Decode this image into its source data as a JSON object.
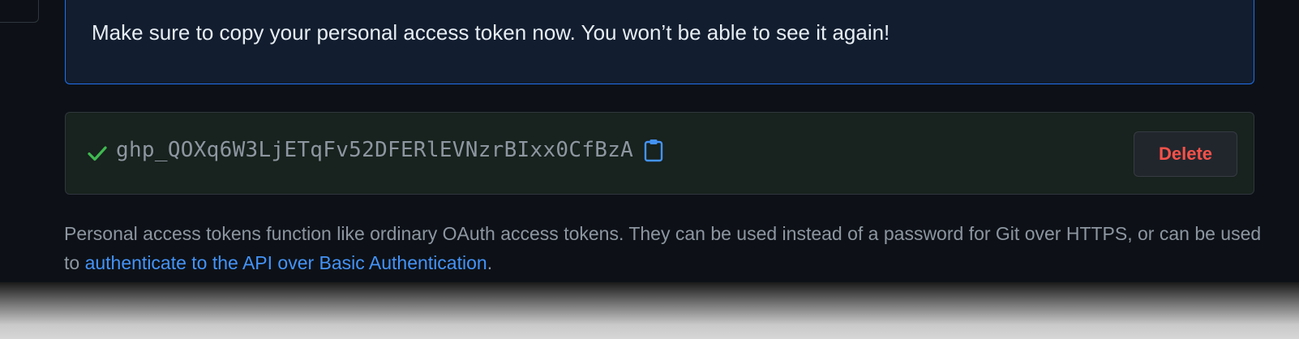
{
  "flash": {
    "message": "Make sure to copy your personal access token now. You won’t be able to see it again!"
  },
  "token": {
    "value": "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",
    "status_icon": "check-icon",
    "copy_icon": "copy-icon",
    "delete_label": "Delete"
  },
  "description": {
    "text_before": "Personal access tokens function like ordinary OAuth access tokens. They can be used instead of a password for Git over HTTPS, or can be used to ",
    "link_text": "authenticate to the API over Basic Authentication",
    "text_after": "."
  },
  "colors": {
    "background": "#0d1117",
    "flash_border": "#1f6feb",
    "success": "#3fb950",
    "danger": "#f85149",
    "link": "#4493f8"
  }
}
